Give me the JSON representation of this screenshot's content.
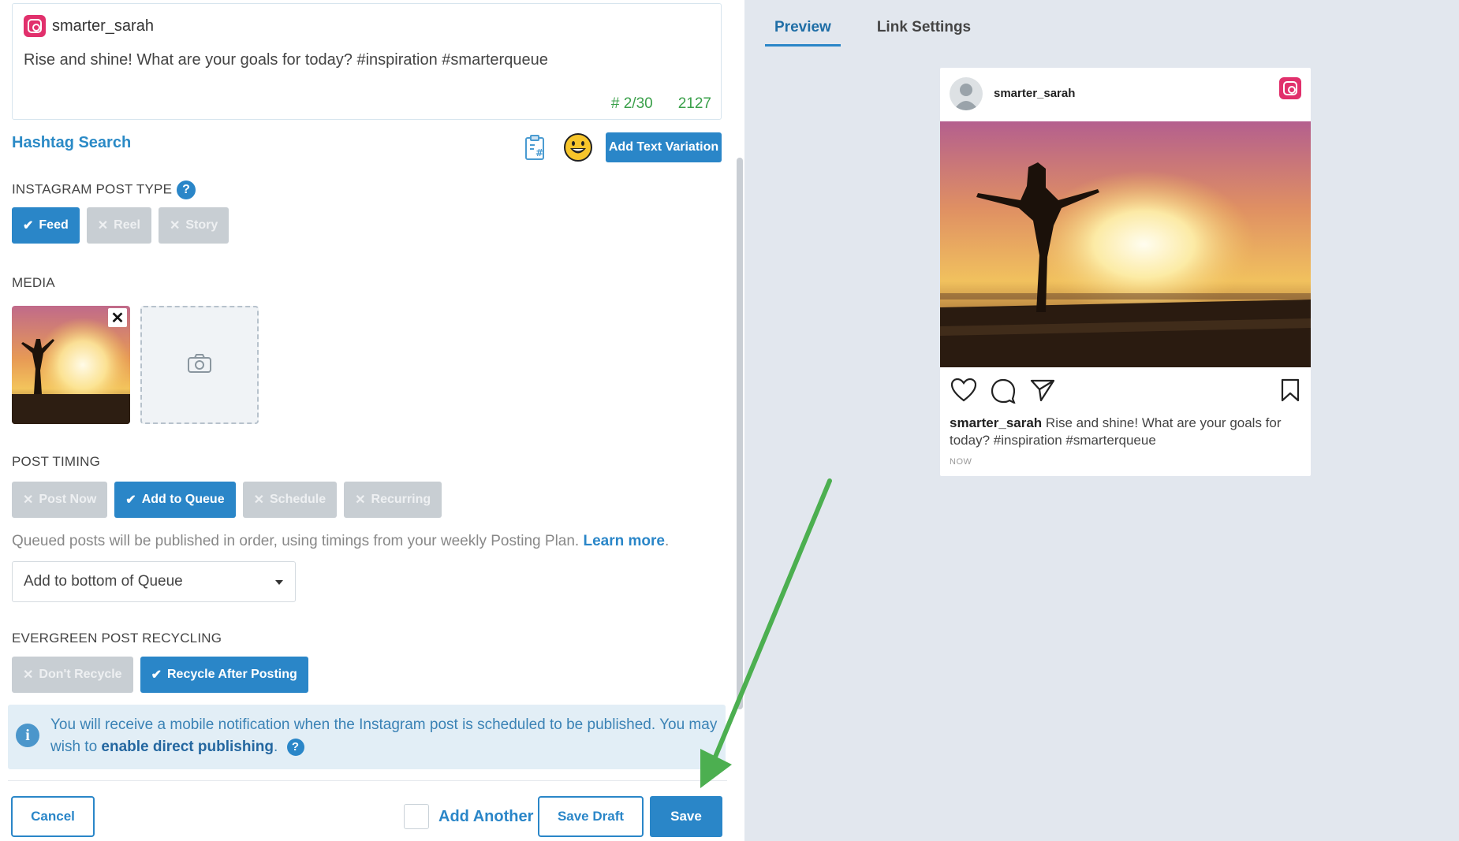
{
  "composer": {
    "account_name": "smarter_sarah",
    "post_text": "Rise and shine! What are your goals for today? #inspiration #smarterqueue",
    "hashtag_count": "# 2/30",
    "char_count": "2127"
  },
  "tools": {
    "hashtag_search_label": "Hashtag Search",
    "add_text_variation_label": "Add Text Variation"
  },
  "post_type": {
    "label": "INSTAGRAM POST TYPE",
    "options": [
      {
        "label": "Feed",
        "selected": true
      },
      {
        "label": "Reel",
        "selected": false
      },
      {
        "label": "Story",
        "selected": false
      }
    ]
  },
  "media": {
    "label": "MEDIA"
  },
  "post_timing": {
    "label": "POST TIMING",
    "options": [
      {
        "label": "Post Now",
        "selected": false
      },
      {
        "label": "Add to Queue",
        "selected": true
      },
      {
        "label": "Schedule",
        "selected": false
      },
      {
        "label": "Recurring",
        "selected": false
      }
    ],
    "note_text": "Queued posts will be published in order, using timings from your weekly Posting Plan. ",
    "note_link": "Learn more",
    "note_end": ".",
    "queue_position": "Add to bottom of Queue"
  },
  "evergreen": {
    "label": "EVERGREEN POST RECYCLING",
    "options": [
      {
        "label": "Don't Recycle",
        "selected": false
      },
      {
        "label": "Recycle After Posting",
        "selected": true
      }
    ]
  },
  "info": {
    "text": "You will receive a mobile notification when the Instagram post is scheduled to be published. You may wish to ",
    "link": "enable direct publishing",
    "end": "."
  },
  "footer": {
    "cancel_label": "Cancel",
    "add_another_label": "Add Another",
    "save_draft_label": "Save Draft",
    "save_label": "Save"
  },
  "preview": {
    "tabs": [
      "Preview",
      "Link Settings"
    ],
    "username": "smarter_sarah",
    "caption_user": "smarter_sarah",
    "caption_text": " Rise and shine! What are your goals for today? #inspiration #smarterqueue",
    "time": "NOW"
  },
  "colors": {
    "accent": "#2a86c8",
    "instagram": "#e1306c",
    "count_green": "#3aa04a",
    "arrow_green": "#4caf50"
  }
}
